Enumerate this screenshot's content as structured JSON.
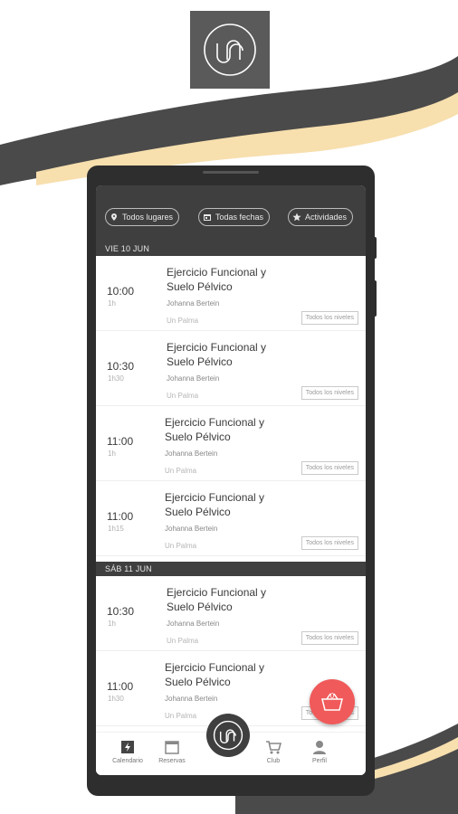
{
  "colors": {
    "accent": "#f05a5a",
    "header": "#3f3f3f",
    "swoosh_dark": "#4a4a4a",
    "swoosh_cream": "#f7dfae"
  },
  "logo": {
    "icon": "un-logo-icon"
  },
  "filters": [
    {
      "label": "Todos lugares",
      "icon": "location-pin-icon"
    },
    {
      "label": "Todas fechas",
      "icon": "calendar-icon"
    },
    {
      "label": "Actividades",
      "icon": "star-icon"
    }
  ],
  "sections": [
    {
      "label": "VIE 10 JUN",
      "classes": [
        {
          "time": "10:00",
          "duration": "1h",
          "title_line1": "Ejercicio Funcional y",
          "title_line2": "Suelo Pélvico",
          "instructor": "Johanna Bertein",
          "location": "Un Palma",
          "level": "Todos los niveles"
        },
        {
          "time": "10:30",
          "duration": "1h30",
          "title_line1": "Ejercicio Funcional y",
          "title_line2": "Suelo Pélvico",
          "instructor": "Johanna Bertein",
          "location": "Un Palma",
          "level": "Todos los niveles"
        },
        {
          "time": "11:00",
          "duration": "1h",
          "title_line1": "Ejercicio Funcional y",
          "title_line2": "Suelo Pélvico",
          "instructor": "Johanna Bertein",
          "location": "Un Palma",
          "level": "Todos los niveles"
        },
        {
          "time": "11:00",
          "duration": "1h15",
          "title_line1": "Ejercicio Funcional y",
          "title_line2": "Suelo Pélvico",
          "instructor": "Johanna Bertein",
          "location": "Un Palma",
          "level": "Todos los niveles"
        }
      ]
    },
    {
      "label": "SÁB 11 JUN",
      "classes": [
        {
          "time": "10:30",
          "duration": "1h",
          "title_line1": "Ejercicio Funcional y",
          "title_line2": "Suelo Pélvico",
          "instructor": "Johanna Bertein",
          "location": "Un Palma",
          "level": "Todos los niveles"
        },
        {
          "time": "11:00",
          "duration": "1h30",
          "title_line1": "Ejercicio Funcional y",
          "title_line2": "Suelo Pélvico",
          "instructor": "Johanna Bertein",
          "location": "Un Palma",
          "level": "Todos los niveles"
        }
      ]
    }
  ],
  "fab": {
    "count": "0",
    "icon": "basket-icon"
  },
  "nav": [
    {
      "label": "Calendario",
      "icon": "calendar-bolt-icon"
    },
    {
      "label": "Reservas",
      "icon": "calendar-icon"
    },
    {
      "label": "",
      "icon": "un-logo-icon"
    },
    {
      "label": "Club",
      "icon": "cart-icon"
    },
    {
      "label": "Perfil",
      "icon": "person-icon"
    }
  ]
}
